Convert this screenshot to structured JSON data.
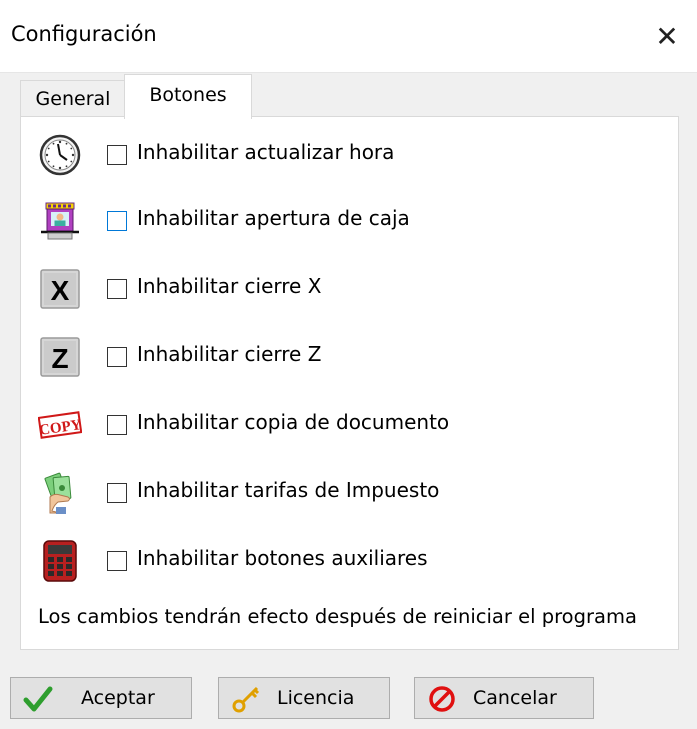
{
  "window": {
    "title": "Configuración",
    "close_glyph": "✕"
  },
  "tabs": [
    {
      "label": "General",
      "selected": false
    },
    {
      "label": "Botones",
      "selected": true
    }
  ],
  "options": [
    {
      "icon": "clock-icon",
      "label": "Inhabilitar actualizar hora",
      "checked": false
    },
    {
      "icon": "cash-drawer-icon",
      "label": "Inhabilitar apertura de caja",
      "checked": false
    },
    {
      "icon": "x-key-icon",
      "key_letter": "X",
      "label": "Inhabilitar cierre X",
      "checked": false
    },
    {
      "icon": "z-key-icon",
      "key_letter": "Z",
      "label": "Inhabilitar cierre Z",
      "checked": false
    },
    {
      "icon": "copy-stamp-icon",
      "stamp_text": "COPY",
      "label": "Inhabilitar copia de documento",
      "checked": false
    },
    {
      "icon": "money-hand-icon",
      "label": "Inhabilitar tarifas de Impuesto",
      "checked": false
    },
    {
      "icon": "calculator-icon",
      "label": "Inhabilitar botones auxiliares",
      "checked": false
    }
  ],
  "note": "Los cambios tendrán efecto después de reiniciar el programa",
  "buttons": {
    "accept": "Aceptar",
    "license": "Licencia",
    "cancel": "Cancelar"
  },
  "colors": {
    "focus_border": "#0078d7",
    "check_green": "#2e9e2e",
    "key_gold": "#e0a000",
    "cancel_red": "#e01010",
    "stamp_red": "#d01818"
  }
}
